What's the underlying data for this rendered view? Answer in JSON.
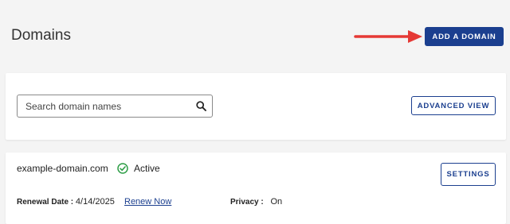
{
  "page": {
    "title": "Domains"
  },
  "header": {
    "add_domain_label": "ADD A DOMAIN"
  },
  "search": {
    "placeholder": "Search domain names",
    "value": ""
  },
  "toolbar": {
    "advanced_view_label": "ADVANCED VIEW"
  },
  "domains": [
    {
      "name": "example-domain.com",
      "status": "Active",
      "renewal_label": "Renewal Date :",
      "renewal_date": "4/14/2025",
      "renew_link": "Renew Now",
      "privacy_label": "Privacy :",
      "privacy_value": "On",
      "settings_label": "SETTINGS"
    }
  ],
  "colors": {
    "brand": "#1b3f8f",
    "arrow": "#e53935",
    "active": "#2e9e47"
  },
  "icons": {
    "search": "search-icon",
    "status": "check-circle-icon",
    "annotation": "red-arrow-icon"
  }
}
